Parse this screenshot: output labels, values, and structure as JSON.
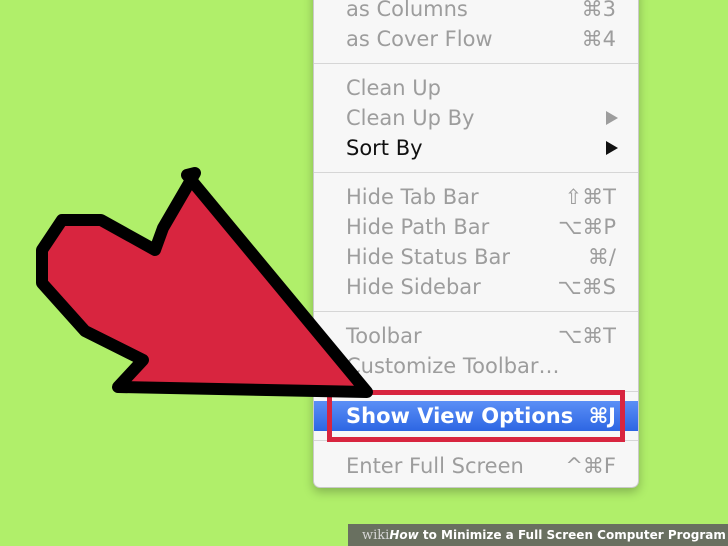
{
  "menu": {
    "items": [
      {
        "label": "as Columns",
        "shortcut": "⌘3"
      },
      {
        "label": "as Cover Flow",
        "shortcut": "⌘4"
      },
      {
        "label": "Clean Up",
        "shortcut": ""
      },
      {
        "label": "Clean Up By",
        "shortcut": ""
      },
      {
        "label": "Sort By",
        "shortcut": ""
      },
      {
        "label": "Hide Tab Bar",
        "shortcut": "⇧⌘T"
      },
      {
        "label": "Hide Path Bar",
        "shortcut": "⌥⌘P"
      },
      {
        "label": "Hide Status Bar",
        "shortcut": "⌘/"
      },
      {
        "label": "Hide Sidebar",
        "shortcut": "⌥⌘S"
      },
      {
        "label": "Toolbar",
        "shortcut": "⌥⌘T"
      },
      {
        "label": "Customize Toolbar…",
        "shortcut": ""
      },
      {
        "label": "Show View Options",
        "shortcut": "⌘J"
      },
      {
        "label": "Enter Full Screen",
        "shortcut": "^⌘F"
      }
    ]
  },
  "colors": {
    "background": "#b0ef6a",
    "arrow": "#d8253f",
    "highlight_box": "#d8253f",
    "menu_selection": "#3a73ea"
  },
  "footer": {
    "brand": "wiki",
    "how": "How",
    "title": " to Minimize a Full Screen Computer Program"
  }
}
